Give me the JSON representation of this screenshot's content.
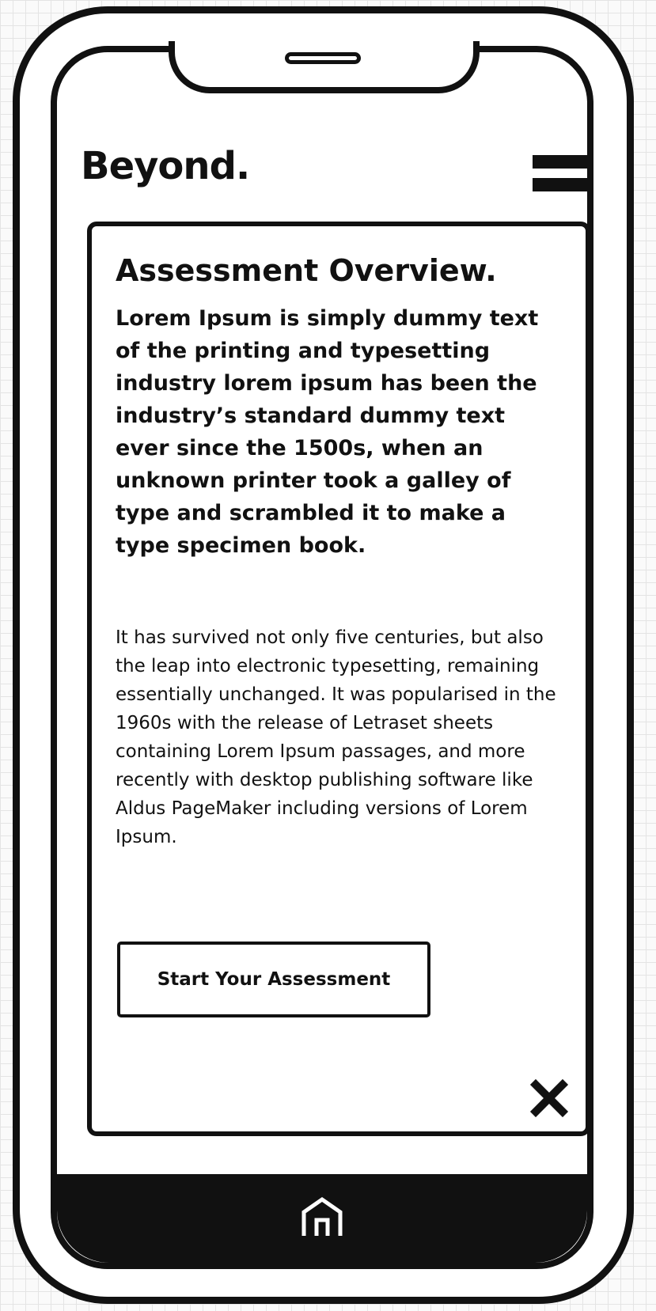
{
  "app": {
    "brand": "Beyond."
  },
  "header": {
    "menu_icon": "hamburger-menu-icon"
  },
  "overview": {
    "title": "Assessment Overview.",
    "lead": "Lorem Ipsum is simply dummy text of the printing and typesetting industry lorem ipsum has been the industry’s standard dummy text ever since the 1500s, when an unknown printer took a galley of type and scrambled it to make a type specimen book.",
    "body": "It has survived not only five centuries, but also the leap into electronic typesetting, remaining essentially unchanged. It was popularised in the 1960s with the release of Letraset sheets containing Lorem Ipsum passages, and more recently with desktop publishing software like Aldus PageMaker including versions of Lorem Ipsum.",
    "cta_label": "Start Your Assessment",
    "close_icon": "close-icon"
  },
  "tabbar": {
    "home_icon": "home-icon"
  },
  "colors": {
    "ink": "#111111",
    "surface": "#ffffff",
    "canvas": "#fafafa",
    "grid": "#e4e4e4"
  }
}
